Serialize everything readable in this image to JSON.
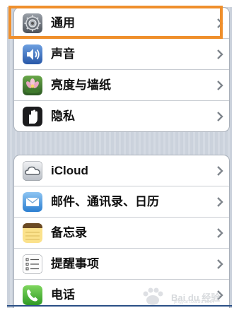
{
  "groups": [
    {
      "items": [
        {
          "label": "通用",
          "icon": "settings-gear-icon"
        },
        {
          "label": "声音",
          "icon": "speaker-icon"
        },
        {
          "label": "亮度与墙纸",
          "icon": "flower-wallpaper-icon"
        },
        {
          "label": "隐私",
          "icon": "hand-privacy-icon"
        }
      ]
    },
    {
      "items": [
        {
          "label": "iCloud",
          "icon": "cloud-icon"
        },
        {
          "label": "邮件、通讯录、日历",
          "icon": "mail-envelope-icon"
        },
        {
          "label": "备忘录",
          "icon": "notes-icon"
        },
        {
          "label": "提醒事项",
          "icon": "reminders-list-icon"
        },
        {
          "label": "电话",
          "icon": "phone-icon"
        }
      ]
    }
  ],
  "highlight_color": "#ef8f2c",
  "watermark": {
    "text": "Bai du 经验",
    "sub": "jingyan.baidu.com"
  }
}
